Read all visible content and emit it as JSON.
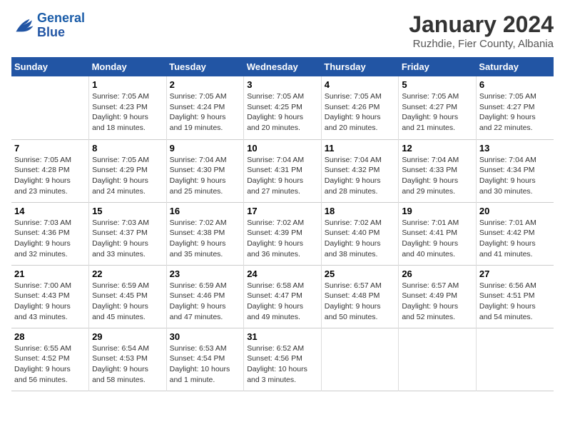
{
  "logo": {
    "line1": "General",
    "line2": "Blue"
  },
  "title": "January 2024",
  "subtitle": "Ruzhdie, Fier County, Albania",
  "days_of_week": [
    "Sunday",
    "Monday",
    "Tuesday",
    "Wednesday",
    "Thursday",
    "Friday",
    "Saturday"
  ],
  "weeks": [
    [
      {
        "num": "",
        "info": ""
      },
      {
        "num": "1",
        "info": "Sunrise: 7:05 AM\nSunset: 4:23 PM\nDaylight: 9 hours\nand 18 minutes."
      },
      {
        "num": "2",
        "info": "Sunrise: 7:05 AM\nSunset: 4:24 PM\nDaylight: 9 hours\nand 19 minutes."
      },
      {
        "num": "3",
        "info": "Sunrise: 7:05 AM\nSunset: 4:25 PM\nDaylight: 9 hours\nand 20 minutes."
      },
      {
        "num": "4",
        "info": "Sunrise: 7:05 AM\nSunset: 4:26 PM\nDaylight: 9 hours\nand 20 minutes."
      },
      {
        "num": "5",
        "info": "Sunrise: 7:05 AM\nSunset: 4:27 PM\nDaylight: 9 hours\nand 21 minutes."
      },
      {
        "num": "6",
        "info": "Sunrise: 7:05 AM\nSunset: 4:27 PM\nDaylight: 9 hours\nand 22 minutes."
      }
    ],
    [
      {
        "num": "7",
        "info": "Sunrise: 7:05 AM\nSunset: 4:28 PM\nDaylight: 9 hours\nand 23 minutes."
      },
      {
        "num": "8",
        "info": "Sunrise: 7:05 AM\nSunset: 4:29 PM\nDaylight: 9 hours\nand 24 minutes."
      },
      {
        "num": "9",
        "info": "Sunrise: 7:04 AM\nSunset: 4:30 PM\nDaylight: 9 hours\nand 25 minutes."
      },
      {
        "num": "10",
        "info": "Sunrise: 7:04 AM\nSunset: 4:31 PM\nDaylight: 9 hours\nand 27 minutes."
      },
      {
        "num": "11",
        "info": "Sunrise: 7:04 AM\nSunset: 4:32 PM\nDaylight: 9 hours\nand 28 minutes."
      },
      {
        "num": "12",
        "info": "Sunrise: 7:04 AM\nSunset: 4:33 PM\nDaylight: 9 hours\nand 29 minutes."
      },
      {
        "num": "13",
        "info": "Sunrise: 7:04 AM\nSunset: 4:34 PM\nDaylight: 9 hours\nand 30 minutes."
      }
    ],
    [
      {
        "num": "14",
        "info": "Sunrise: 7:03 AM\nSunset: 4:36 PM\nDaylight: 9 hours\nand 32 minutes."
      },
      {
        "num": "15",
        "info": "Sunrise: 7:03 AM\nSunset: 4:37 PM\nDaylight: 9 hours\nand 33 minutes."
      },
      {
        "num": "16",
        "info": "Sunrise: 7:02 AM\nSunset: 4:38 PM\nDaylight: 9 hours\nand 35 minutes."
      },
      {
        "num": "17",
        "info": "Sunrise: 7:02 AM\nSunset: 4:39 PM\nDaylight: 9 hours\nand 36 minutes."
      },
      {
        "num": "18",
        "info": "Sunrise: 7:02 AM\nSunset: 4:40 PM\nDaylight: 9 hours\nand 38 minutes."
      },
      {
        "num": "19",
        "info": "Sunrise: 7:01 AM\nSunset: 4:41 PM\nDaylight: 9 hours\nand 40 minutes."
      },
      {
        "num": "20",
        "info": "Sunrise: 7:01 AM\nSunset: 4:42 PM\nDaylight: 9 hours\nand 41 minutes."
      }
    ],
    [
      {
        "num": "21",
        "info": "Sunrise: 7:00 AM\nSunset: 4:43 PM\nDaylight: 9 hours\nand 43 minutes."
      },
      {
        "num": "22",
        "info": "Sunrise: 6:59 AM\nSunset: 4:45 PM\nDaylight: 9 hours\nand 45 minutes."
      },
      {
        "num": "23",
        "info": "Sunrise: 6:59 AM\nSunset: 4:46 PM\nDaylight: 9 hours\nand 47 minutes."
      },
      {
        "num": "24",
        "info": "Sunrise: 6:58 AM\nSunset: 4:47 PM\nDaylight: 9 hours\nand 49 minutes."
      },
      {
        "num": "25",
        "info": "Sunrise: 6:57 AM\nSunset: 4:48 PM\nDaylight: 9 hours\nand 50 minutes."
      },
      {
        "num": "26",
        "info": "Sunrise: 6:57 AM\nSunset: 4:49 PM\nDaylight: 9 hours\nand 52 minutes."
      },
      {
        "num": "27",
        "info": "Sunrise: 6:56 AM\nSunset: 4:51 PM\nDaylight: 9 hours\nand 54 minutes."
      }
    ],
    [
      {
        "num": "28",
        "info": "Sunrise: 6:55 AM\nSunset: 4:52 PM\nDaylight: 9 hours\nand 56 minutes."
      },
      {
        "num": "29",
        "info": "Sunrise: 6:54 AM\nSunset: 4:53 PM\nDaylight: 9 hours\nand 58 minutes."
      },
      {
        "num": "30",
        "info": "Sunrise: 6:53 AM\nSunset: 4:54 PM\nDaylight: 10 hours\nand 1 minute."
      },
      {
        "num": "31",
        "info": "Sunrise: 6:52 AM\nSunset: 4:56 PM\nDaylight: 10 hours\nand 3 minutes."
      },
      {
        "num": "",
        "info": ""
      },
      {
        "num": "",
        "info": ""
      },
      {
        "num": "",
        "info": ""
      }
    ]
  ]
}
